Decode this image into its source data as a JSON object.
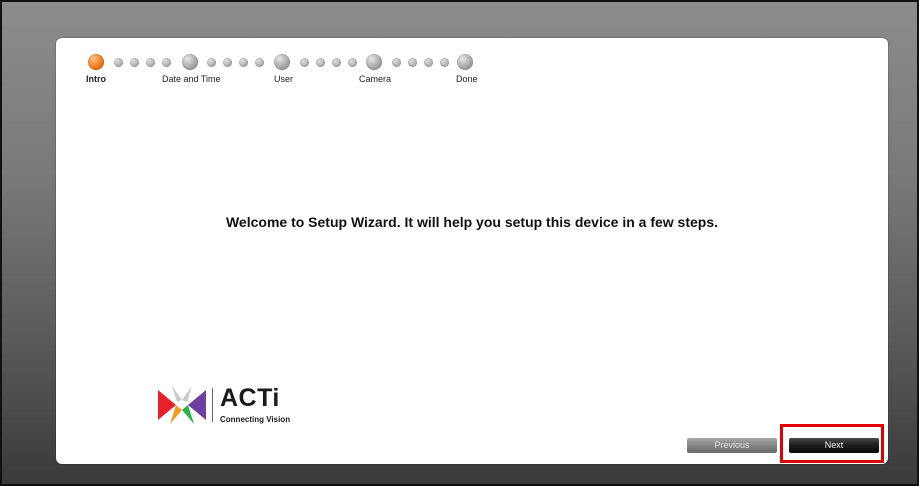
{
  "wizard": {
    "steps": [
      {
        "label": "Intro",
        "active": true
      },
      {
        "label": "Date and Time",
        "active": false
      },
      {
        "label": "User",
        "active": false
      },
      {
        "label": "Camera",
        "active": false
      },
      {
        "label": "Done",
        "active": false
      }
    ],
    "welcome_text": "Welcome to Setup Wizard. It will help you setup this device in a few steps."
  },
  "logo": {
    "brand": "ACTi",
    "tagline": "Connecting Vision"
  },
  "buttons": {
    "previous_label": "Previous",
    "next_label": "Next"
  },
  "colors": {
    "active_step": "#f07a1c",
    "inactive_step": "#a8a8a8",
    "highlight": "#e00000",
    "logo_red": "#e8202a",
    "logo_orange": "#f39a1c",
    "logo_green": "#2bb24c",
    "logo_purple": "#6d3fa0"
  }
}
